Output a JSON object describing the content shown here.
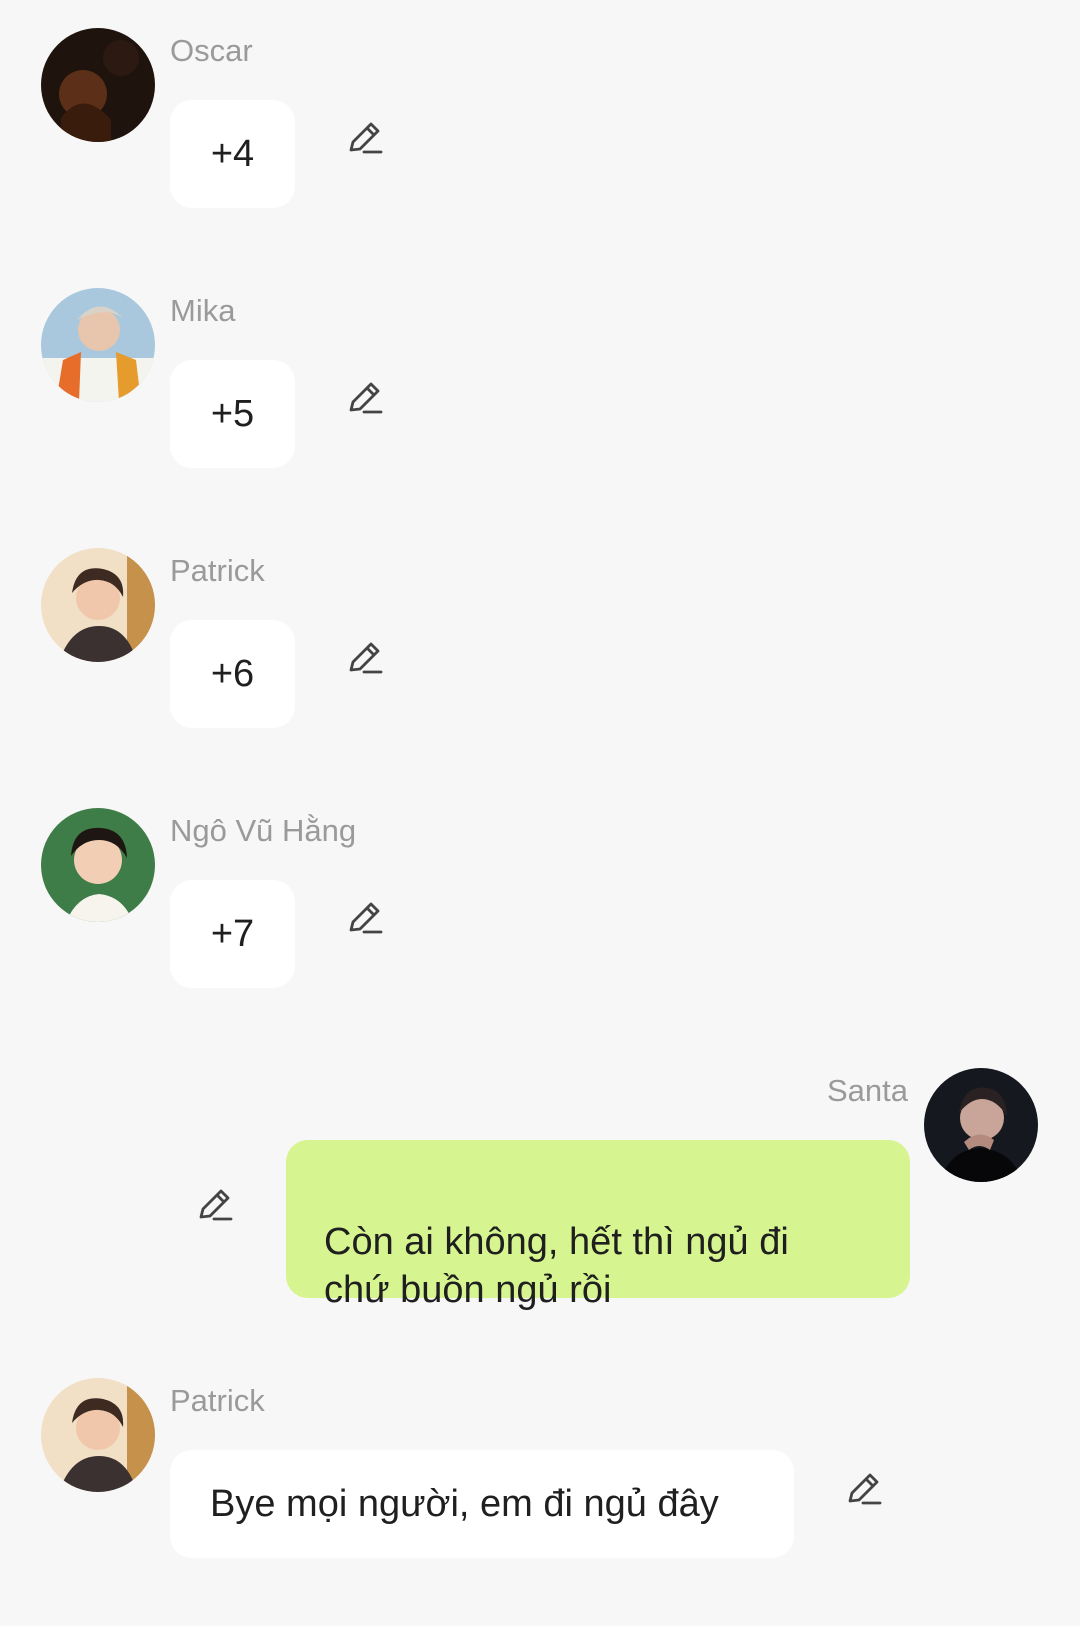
{
  "messages": [
    {
      "sender": "Oscar",
      "text": "+4",
      "avatar_tone": "dark"
    },
    {
      "sender": "Mika",
      "text": "+5",
      "avatar_tone": "light"
    },
    {
      "sender": "Patrick",
      "text": "+6",
      "avatar_tone": "warm"
    },
    {
      "sender": "Ngô Vũ Hằng",
      "text": "+7",
      "avatar_tone": "green"
    },
    {
      "sender": "Santa",
      "text": "Còn ai không, hết thì ngủ đi\nchứ buồn ngủ rồi",
      "avatar_tone": "night"
    },
    {
      "sender": "Patrick",
      "text": "Bye mọi người, em đi ngủ đây",
      "avatar_tone": "warm"
    }
  ],
  "colors": {
    "background": "#f7f7f7",
    "bubble": "#ffffff",
    "own_bubble": "#d6f48f",
    "sender_text": "#9a9a9a",
    "message_text": "#1f1f1f"
  },
  "icons": {
    "edit": "pencil-edit-icon",
    "avatar": "avatar-photo"
  }
}
